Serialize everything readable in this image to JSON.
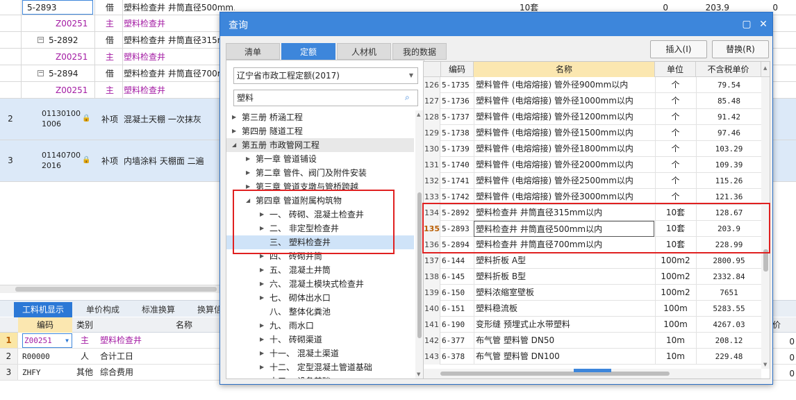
{
  "background": {
    "rows": [
      {
        "code": "5-2893",
        "type": "借",
        "name": "塑料检查井 井筒直径500mm以内",
        "unit": "10套",
        "qty": "0",
        "price": "203.9",
        "extra": "0"
      },
      {
        "code": "Z00251",
        "type": "主",
        "name": "塑料检查井"
      },
      {
        "code": "5-2892",
        "type": "借",
        "name": "塑料检查井 井筒直径315m"
      },
      {
        "code": "Z00251",
        "type": "主",
        "name": "塑料检查井"
      },
      {
        "code": "5-2894",
        "type": "借",
        "name": "塑料检查井 井筒直径700m"
      },
      {
        "code": "Z00251",
        "type": "主",
        "name": "塑料检查井"
      },
      {
        "num": "2",
        "code1": "01130100",
        "code2": "1006",
        "type": "补项",
        "name": "混凝土天棚 一次抹灰"
      },
      {
        "num": "3",
        "code1": "01140700",
        "code2": "2016",
        "type": "补项",
        "name": "内墙涂料 天棚面 二遍"
      }
    ],
    "bottom_tabs": [
      "工料机显示",
      "单价构成",
      "标准换算",
      "换算信"
    ],
    "sub_headers": {
      "code": "编码",
      "type": "类别",
      "name": "名称",
      "right": "价"
    },
    "sub_rows": [
      {
        "num": "1",
        "code": "Z00251",
        "type": "主",
        "name": "塑料检查井"
      },
      {
        "num": "2",
        "code": "R00000",
        "type": "人",
        "name": "合计工日"
      },
      {
        "num": "3",
        "code": "ZHFY",
        "type": "其他",
        "name": "综合费用"
      }
    ],
    "right_zeros": [
      "0",
      "0",
      "0"
    ]
  },
  "dialog": {
    "title": "查询",
    "maximize_icon": "maximize-icon",
    "close_icon": "close-icon",
    "tabs": [
      "清单",
      "定额",
      "人材机",
      "我的数据"
    ],
    "active_tab": "定额",
    "insert_button": "插入(I)",
    "replace_button": "替换(R)",
    "database": "辽宁省市政工程定额(2017)",
    "search_value": "塑料",
    "tree": [
      {
        "label": "第三册 桥涵工程",
        "level": 0,
        "arrow": "right"
      },
      {
        "label": "第四册 隧道工程",
        "level": 0,
        "arrow": "right"
      },
      {
        "label": "第五册 市政管网工程",
        "level": 0,
        "arrow": "down"
      },
      {
        "label": "第一章 管道铺设",
        "level": 1,
        "arrow": "right"
      },
      {
        "label": "第二章 管件、阀门及附件安装",
        "level": 1,
        "arrow": "right"
      },
      {
        "label": "第三章 管道支墩与管桥跨越",
        "level": 1,
        "arrow": "right"
      },
      {
        "label": "第四章 管道附属构筑物",
        "level": 1,
        "arrow": "down"
      },
      {
        "label": "一、 砖砌、混凝土检查井",
        "level": 2,
        "arrow": "right"
      },
      {
        "label": "二、 非定型检查井",
        "level": 2,
        "arrow": "right"
      },
      {
        "label": "三、 塑料检查井",
        "level": 2,
        "arrow": "none"
      },
      {
        "label": "四、 砖砌井筒",
        "level": 2,
        "arrow": "right"
      },
      {
        "label": "五、 混凝土井筒",
        "level": 2,
        "arrow": "right"
      },
      {
        "label": "六、 混凝土模块式检查井",
        "level": 2,
        "arrow": "right"
      },
      {
        "label": "七、 砌体出水口",
        "level": 2,
        "arrow": "right"
      },
      {
        "label": "八、 整体化粪池",
        "level": 2,
        "arrow": "none"
      },
      {
        "label": "九、 雨水口",
        "level": 2,
        "arrow": "right"
      },
      {
        "label": "十、 砖砌渠道",
        "level": 2,
        "arrow": "right"
      },
      {
        "label": "十一、 混凝土渠道",
        "level": 2,
        "arrow": "right"
      },
      {
        "label": "十二、 定型混凝土管道基础",
        "level": 2,
        "arrow": "right"
      },
      {
        "label": "十三、 设备基础",
        "level": 2,
        "arrow": "right"
      }
    ],
    "grid_headers": {
      "code": "编码",
      "name": "名称",
      "unit": "单位",
      "price": "不含税单价"
    },
    "grid_rows": [
      {
        "idx": "126",
        "code": "5-1735",
        "name": "塑料管件 (电熔熔接) 管外径900mm以内",
        "unit": "个",
        "price": "79.54"
      },
      {
        "idx": "127",
        "code": "5-1736",
        "name": "塑料管件 (电熔熔接) 管外径1000mm以内",
        "unit": "个",
        "price": "85.48"
      },
      {
        "idx": "128",
        "code": "5-1737",
        "name": "塑料管件 (电熔熔接) 管外径1200mm以内",
        "unit": "个",
        "price": "91.42"
      },
      {
        "idx": "129",
        "code": "5-1738",
        "name": "塑料管件 (电熔熔接) 管外径1500mm以内",
        "unit": "个",
        "price": "97.46"
      },
      {
        "idx": "130",
        "code": "5-1739",
        "name": "塑料管件 (电熔熔接) 管外径1800mm以内",
        "unit": "个",
        "price": "103.29"
      },
      {
        "idx": "131",
        "code": "5-1740",
        "name": "塑料管件 (电熔熔接) 管外径2000mm以内",
        "unit": "个",
        "price": "109.39"
      },
      {
        "idx": "132",
        "code": "5-1741",
        "name": "塑料管件 (电熔熔接) 管外径2500mm以内",
        "unit": "个",
        "price": "115.26"
      },
      {
        "idx": "133",
        "code": "5-1742",
        "name": "塑料管件 (电熔熔接) 管外径3000mm以内",
        "unit": "个",
        "price": "121.36"
      },
      {
        "idx": "134",
        "code": "5-2892",
        "name": "塑料检查井 井筒直径315mm以内",
        "unit": "10套",
        "price": "128.67"
      },
      {
        "idx": "135",
        "code": "5-2893",
        "name": "塑料检查井 井筒直径500mm以内",
        "unit": "10套",
        "price": "203.9"
      },
      {
        "idx": "136",
        "code": "5-2894",
        "name": "塑料检查井 井筒直径700mm以内",
        "unit": "10套",
        "price": "228.99"
      },
      {
        "idx": "137",
        "code": "6-144",
        "name": "塑料折板 A型",
        "unit": "100m2",
        "price": "2800.95"
      },
      {
        "idx": "138",
        "code": "6-145",
        "name": "塑料折板 B型",
        "unit": "100m2",
        "price": "2332.84"
      },
      {
        "idx": "139",
        "code": "6-150",
        "name": "塑料浓缩室壁板",
        "unit": "100m2",
        "price": "7651"
      },
      {
        "idx": "140",
        "code": "6-151",
        "name": "塑料稳流板",
        "unit": "100m",
        "price": "5283.55"
      },
      {
        "idx": "141",
        "code": "6-190",
        "name": "变形缝 预埋式止水带塑料",
        "unit": "100m",
        "price": "4267.03"
      },
      {
        "idx": "142",
        "code": "6-377",
        "name": "布气管 塑料管 DN50",
        "unit": "10m",
        "price": "208.12"
      },
      {
        "idx": "143",
        "code": "6-378",
        "name": "布气管 塑料管 DN100",
        "unit": "10m",
        "price": "229.48"
      }
    ],
    "active_row": "135"
  }
}
